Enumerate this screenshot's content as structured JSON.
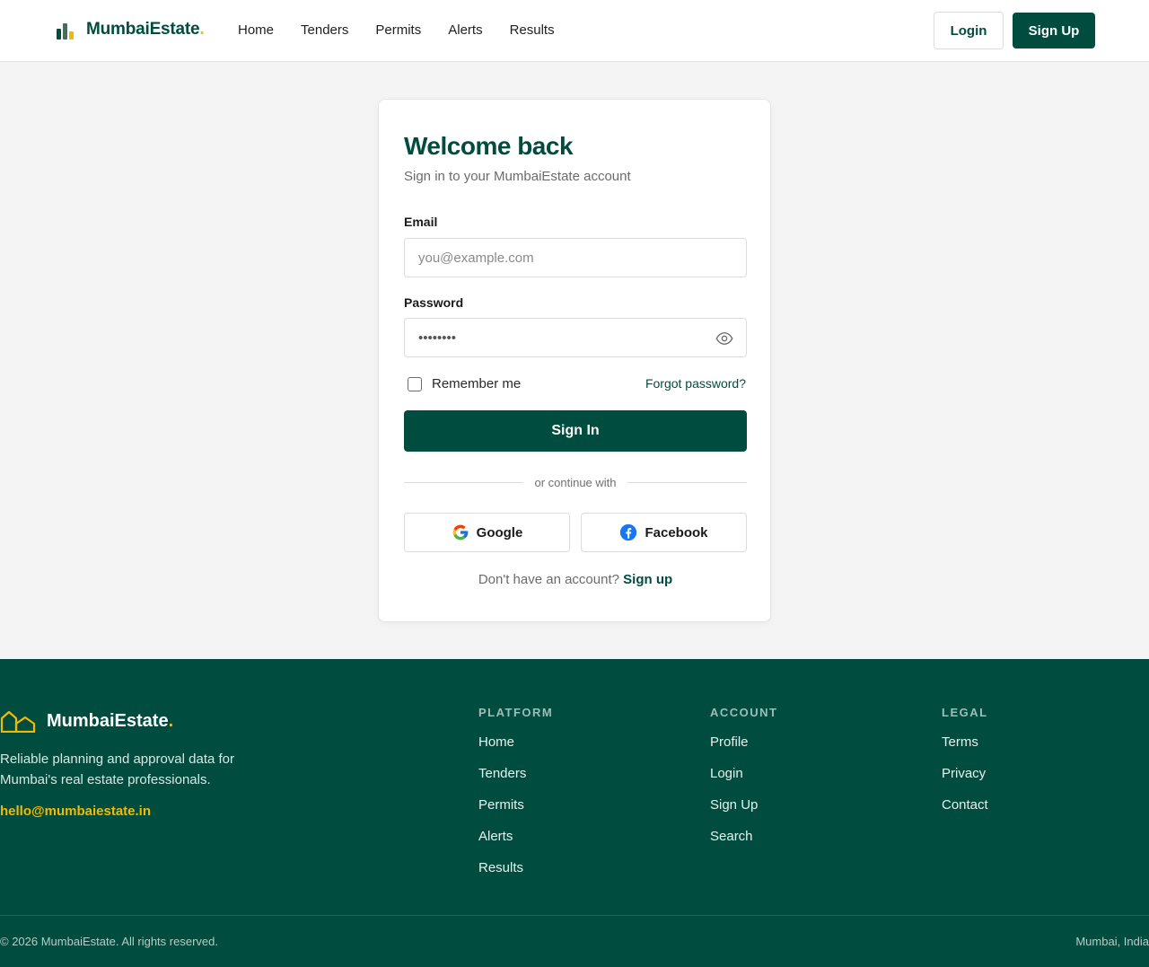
{
  "colors": {
    "brand_green": "#004d40",
    "accent_yellow": "#f5b800",
    "page_bg": "#f4f4f4"
  },
  "header": {
    "brand_name": "MumbaiEstate",
    "brand_dot": ".",
    "logo_icon": "bar-chart-icon",
    "nav": [
      "Home",
      "Tenders",
      "Permits",
      "Alerts",
      "Results"
    ],
    "login_label": "Login",
    "signup_label": "Sign Up"
  },
  "login_card": {
    "title": "Welcome back",
    "subtitle": "Sign in to your MumbaiEstate account",
    "email_label": "Email",
    "email_placeholder": "you@example.com",
    "password_label": "Password",
    "password_value": "••••••••",
    "show_password_icon": "eye-icon",
    "remember_label": "Remember me",
    "remember_checked": false,
    "forgot_label": "Forgot password?",
    "signin_label": "Sign In",
    "divider_text": "or continue with",
    "google_label": "Google",
    "facebook_label": "Facebook",
    "no_account_text": "Don't have an account?",
    "signup_link": "Sign up"
  },
  "footer": {
    "brand_name": "MumbaiEstate",
    "brand_dot": ".",
    "logo_icon": "houses-icon",
    "description": "Reliable planning and approval data for Mumbai's real estate professionals.",
    "email": "hello@mumbaiestate.in",
    "columns": [
      {
        "heading": "PLATFORM",
        "links": [
          "Home",
          "Tenders",
          "Permits",
          "Alerts",
          "Results"
        ]
      },
      {
        "heading": "ACCOUNT",
        "links": [
          "Profile",
          "Login",
          "Sign Up",
          "Search"
        ]
      },
      {
        "heading": "LEGAL",
        "links": [
          "Terms",
          "Privacy",
          "Contact"
        ]
      }
    ],
    "copyright": "© 2026 MumbaiEstate. All rights reserved.",
    "location": "Mumbai, India"
  }
}
